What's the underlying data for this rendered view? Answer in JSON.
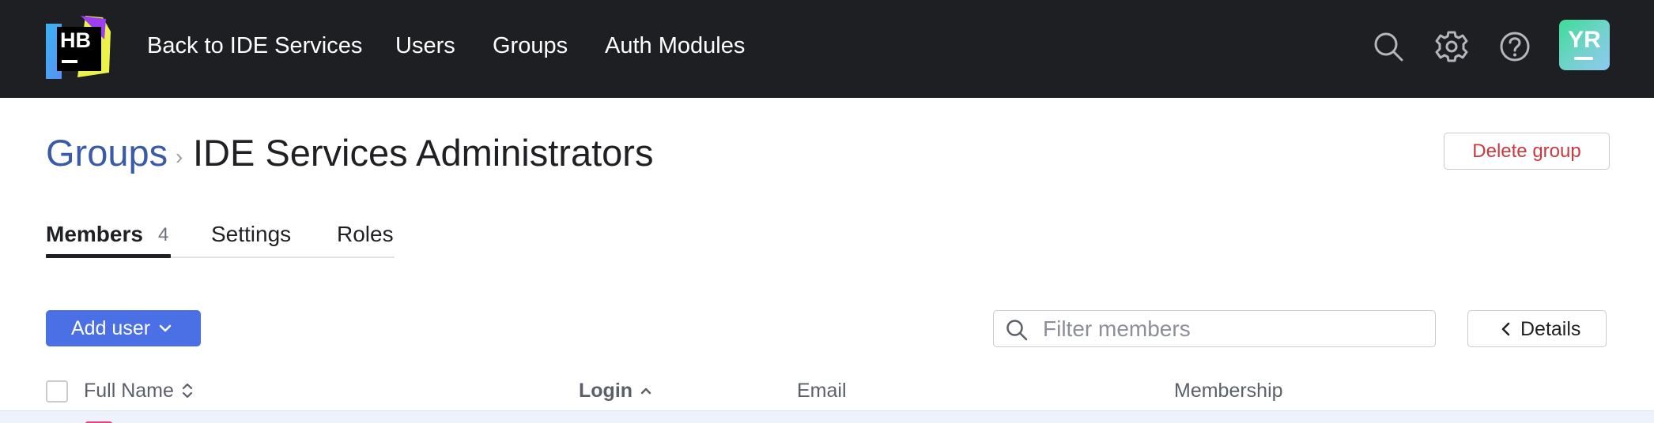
{
  "topbar": {
    "logo_text": "HB",
    "nav": [
      {
        "label": "Back to IDE Services"
      },
      {
        "label": "Users"
      },
      {
        "label": "Groups"
      },
      {
        "label": "Auth Modules"
      }
    ],
    "icons": [
      "search-icon",
      "gear-icon",
      "help-icon"
    ],
    "avatar_initials": "YR",
    "background": "#1e1f23"
  },
  "header": {
    "breadcrumb_link": "Groups",
    "breadcrumb_separator": "›",
    "title": "IDE Services Administrators",
    "delete_label": "Delete group",
    "delete_color": "#c9393f",
    "link_color": "#3a5ba8"
  },
  "tabs": [
    {
      "label": "Members",
      "count": "4",
      "active": true
    },
    {
      "label": "Settings",
      "active": false
    },
    {
      "label": "Roles",
      "active": false
    }
  ],
  "toolbar": {
    "add_label": "Add user",
    "add_color": "#4b6fe4",
    "filter_placeholder": "Filter members",
    "details_label": "Details"
  },
  "table": {
    "columns": [
      {
        "label": "Full Name",
        "sort": "sortable"
      },
      {
        "label": "Login",
        "sort": "ascending"
      },
      {
        "label": "Email",
        "sort": "none"
      },
      {
        "label": "Membership",
        "sort": "none"
      }
    ]
  }
}
